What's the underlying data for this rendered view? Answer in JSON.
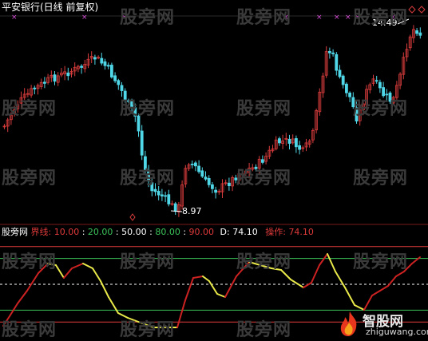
{
  "title": "平安银行(日线 前复权)",
  "price_high_label": "14.49",
  "price_low_label": "8.97",
  "indicator": {
    "name": "股旁网",
    "jx_label": "界线:",
    "levels": [
      "10.00",
      "20.00",
      "50.00",
      "80.00",
      "90.00"
    ],
    "d_label": "D:",
    "d_value": "74.10",
    "op_label": "操作:",
    "op_value": "74.10"
  },
  "watermark": "股旁网",
  "logo_text": "智股网",
  "logo_url": "zhiguwang.com",
  "colors": {
    "bg": "#000000",
    "up": "#d93c3c",
    "down": "#4fd7e8",
    "line_red": "#cc2222",
    "line_yellow": "#e9e94a",
    "level_red": "#e03a3a",
    "level_green": "#3bc35a",
    "level_white": "#ffffff",
    "x_marker": "#d94fd9"
  },
  "icons": [
    "fire-icon",
    "diamond-icon"
  ]
}
